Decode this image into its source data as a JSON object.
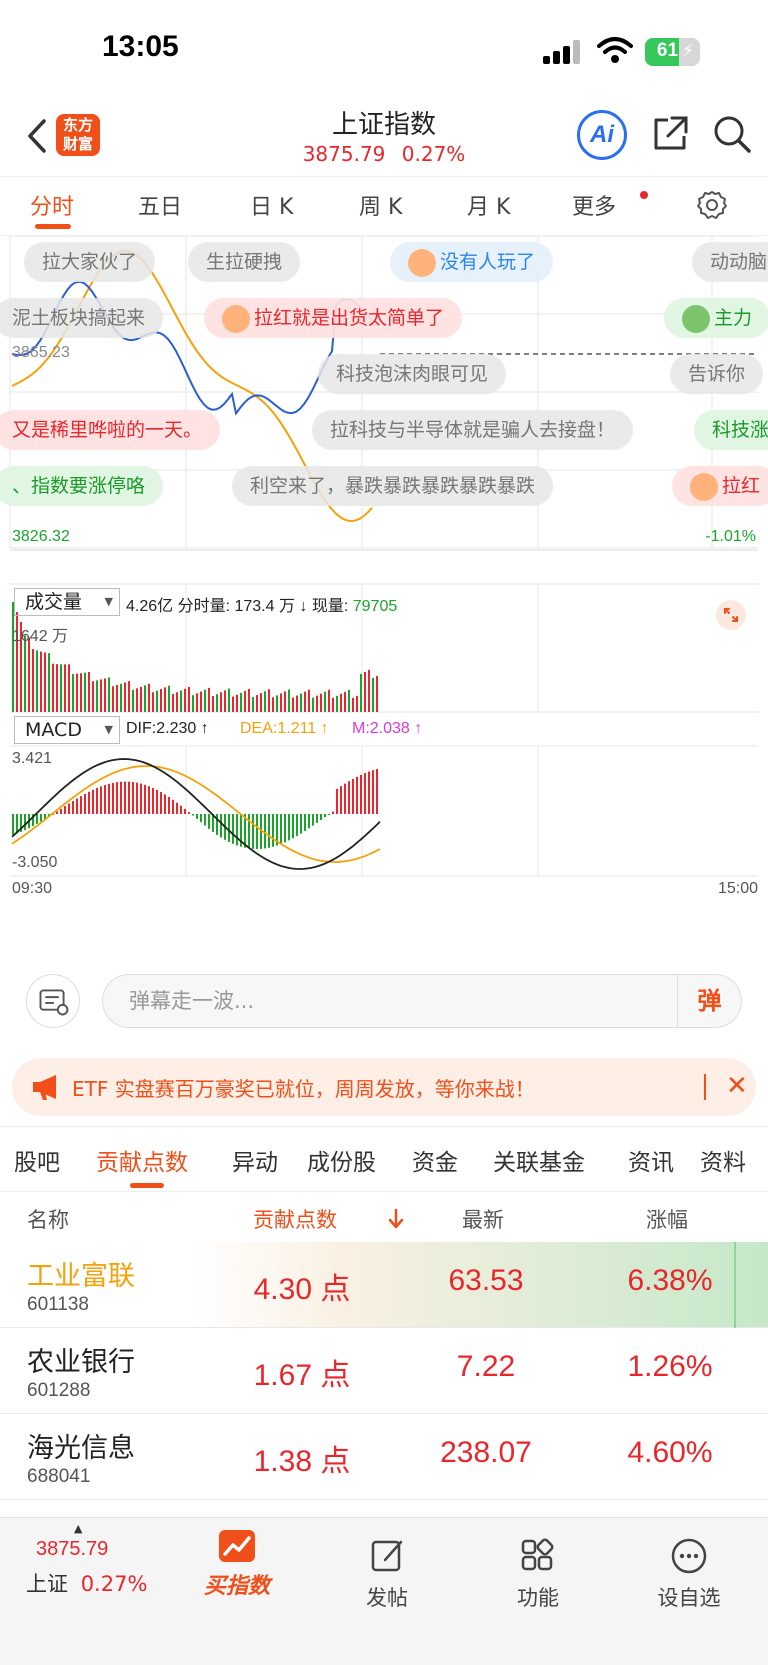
{
  "status": {
    "time": "13:05",
    "battery": "61"
  },
  "header": {
    "title": "上证指数",
    "price": "3875.79",
    "change": "0.27%",
    "logo_line1": "东方",
    "logo_line2": "财富",
    "ai_label": "Ai"
  },
  "tabs": [
    "分时",
    "五日",
    "日 K",
    "周 K",
    "月 K",
    "更多"
  ],
  "chart": {
    "high_label": "3865.23",
    "low_label": "3826.32",
    "low_pct": "-1.01%",
    "volume_select": "成交量",
    "volume_info": "4.26亿  分时量: 173.4 万 ↓ 现量: ",
    "volume_now": "79705",
    "volume_max": "1642 万",
    "macd_select": "MACD",
    "macd_dif": "DIF:2.230 ↑",
    "macd_dea": "DEA:1.211 ↑",
    "macd_m": "M:2.038 ↑",
    "macd_max": "3.421",
    "macd_min": "-3.050",
    "time_start": "09:30",
    "time_end": "15:00",
    "colors": {
      "up": "#e8262b",
      "down": "#1aa52a",
      "price_line": "#2b5fcf",
      "avg_line": "#f5a10c"
    }
  },
  "danmaku": [
    {
      "text": "拉大家伙了",
      "style": "gray"
    },
    {
      "text": "生拉硬拽",
      "style": "gray"
    },
    {
      "text": "没有人玩了",
      "style": "blue"
    },
    {
      "text": "动动脑",
      "style": "gray"
    },
    {
      "text": "泥土板块搞起来",
      "style": "gray"
    },
    {
      "text": "拉红就是出货太简单了",
      "style": "red"
    },
    {
      "text": "主力",
      "style": "green"
    },
    {
      "text": "科技泡沫肉眼可见",
      "style": "gray"
    },
    {
      "text": "告诉你",
      "style": "gray"
    },
    {
      "text": "又是稀里哗啦的一天。",
      "style": "red"
    },
    {
      "text": "拉科技与半导体就是骗人去接盘！",
      "style": "gray"
    },
    {
      "text": "科技涨",
      "style": "green"
    },
    {
      "text": "、指数要涨停咯",
      "style": "green"
    },
    {
      "text": "利空来了，暴跌暴跌暴跌暴跌暴跌",
      "style": "gray"
    },
    {
      "text": "拉红",
      "style": "red"
    }
  ],
  "comment": {
    "placeholder": "弹幕走一波...",
    "button": "弹"
  },
  "banner": {
    "text": "ETF 实盘赛百万豪奖已就位，周周发放，等你来战！"
  },
  "section_tabs": [
    "股吧",
    "贡献点数",
    "异动",
    "成份股",
    "资金",
    "关联基金",
    "资讯",
    "资料"
  ],
  "table": {
    "headers": [
      "名称",
      "贡献点数",
      "最新",
      "涨幅"
    ],
    "rows": [
      {
        "name": "工业富联",
        "code": "601138",
        "points": "4.30 点",
        "price": "63.53",
        "change": "6.38%"
      },
      {
        "name": "农业银行",
        "code": "601288",
        "points": "1.67 点",
        "price": "7.22",
        "change": "1.26%"
      },
      {
        "name": "海光信息",
        "code": "688041",
        "points": "1.38 点",
        "price": "238.07",
        "change": "4.60%"
      }
    ]
  },
  "bottom_nav": {
    "index_price": "3875.79",
    "index_name": "上证",
    "index_change": "0.27%",
    "items": [
      "买指数",
      "发帖",
      "功能",
      "设自选"
    ]
  }
}
